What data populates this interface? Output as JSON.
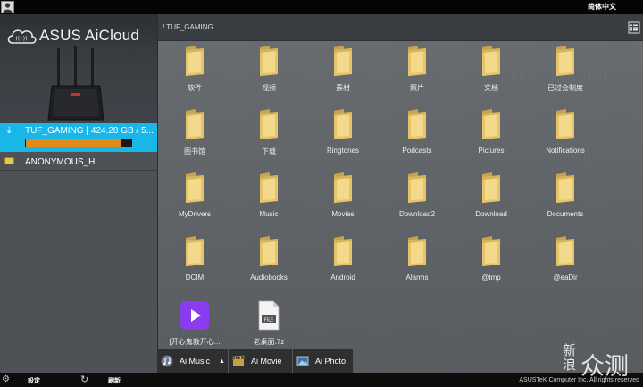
{
  "topbar": {
    "language": "简体中文"
  },
  "sidebar": {
    "brand": "ASUS AiCloud",
    "drives": [
      {
        "label": "TUF_GAMING [ 424.28 GB / 5...",
        "usage": 0.9
      },
      {
        "label": "ANONYMOUS_H"
      }
    ]
  },
  "main": {
    "path": "/ TUF_GAMING",
    "folders": [
      "软件",
      "视频",
      "素材",
      "照片",
      "文档",
      "已过会制度",
      "图书馆",
      "下载",
      "Ringtones",
      "Podcasts",
      "Pictures",
      "Notifications",
      "MyDrivers",
      "Music",
      "Movies",
      "Download2",
      "Download",
      "Documents",
      "DCIM",
      "Audiobooks",
      "Android",
      "Alarms",
      "@tmp",
      "@eaDir"
    ],
    "files": [
      {
        "name": "[开心鬼救开心...",
        "icon": "video-file-icon"
      },
      {
        "name": "老桌面.7z",
        "icon": "archive-file-icon",
        "badge": "FILE"
      }
    ]
  },
  "apps": [
    {
      "label": "Ai Music",
      "icon": "music-icon"
    },
    {
      "label": "Ai Movie",
      "icon": "movie-clapper-icon"
    },
    {
      "label": "Ai Photo",
      "icon": "photo-icon"
    }
  ],
  "status": {
    "settings_label": "設定",
    "refresh_label": "刷新",
    "copyright": "ASUSTeK Computer Inc. All rights reserved"
  },
  "watermark": {
    "line1": "新浪",
    "line2": "众测"
  },
  "colors": {
    "accent": "#19b6e8",
    "progress": "#e08a1a",
    "folder": "#e6c46a"
  }
}
